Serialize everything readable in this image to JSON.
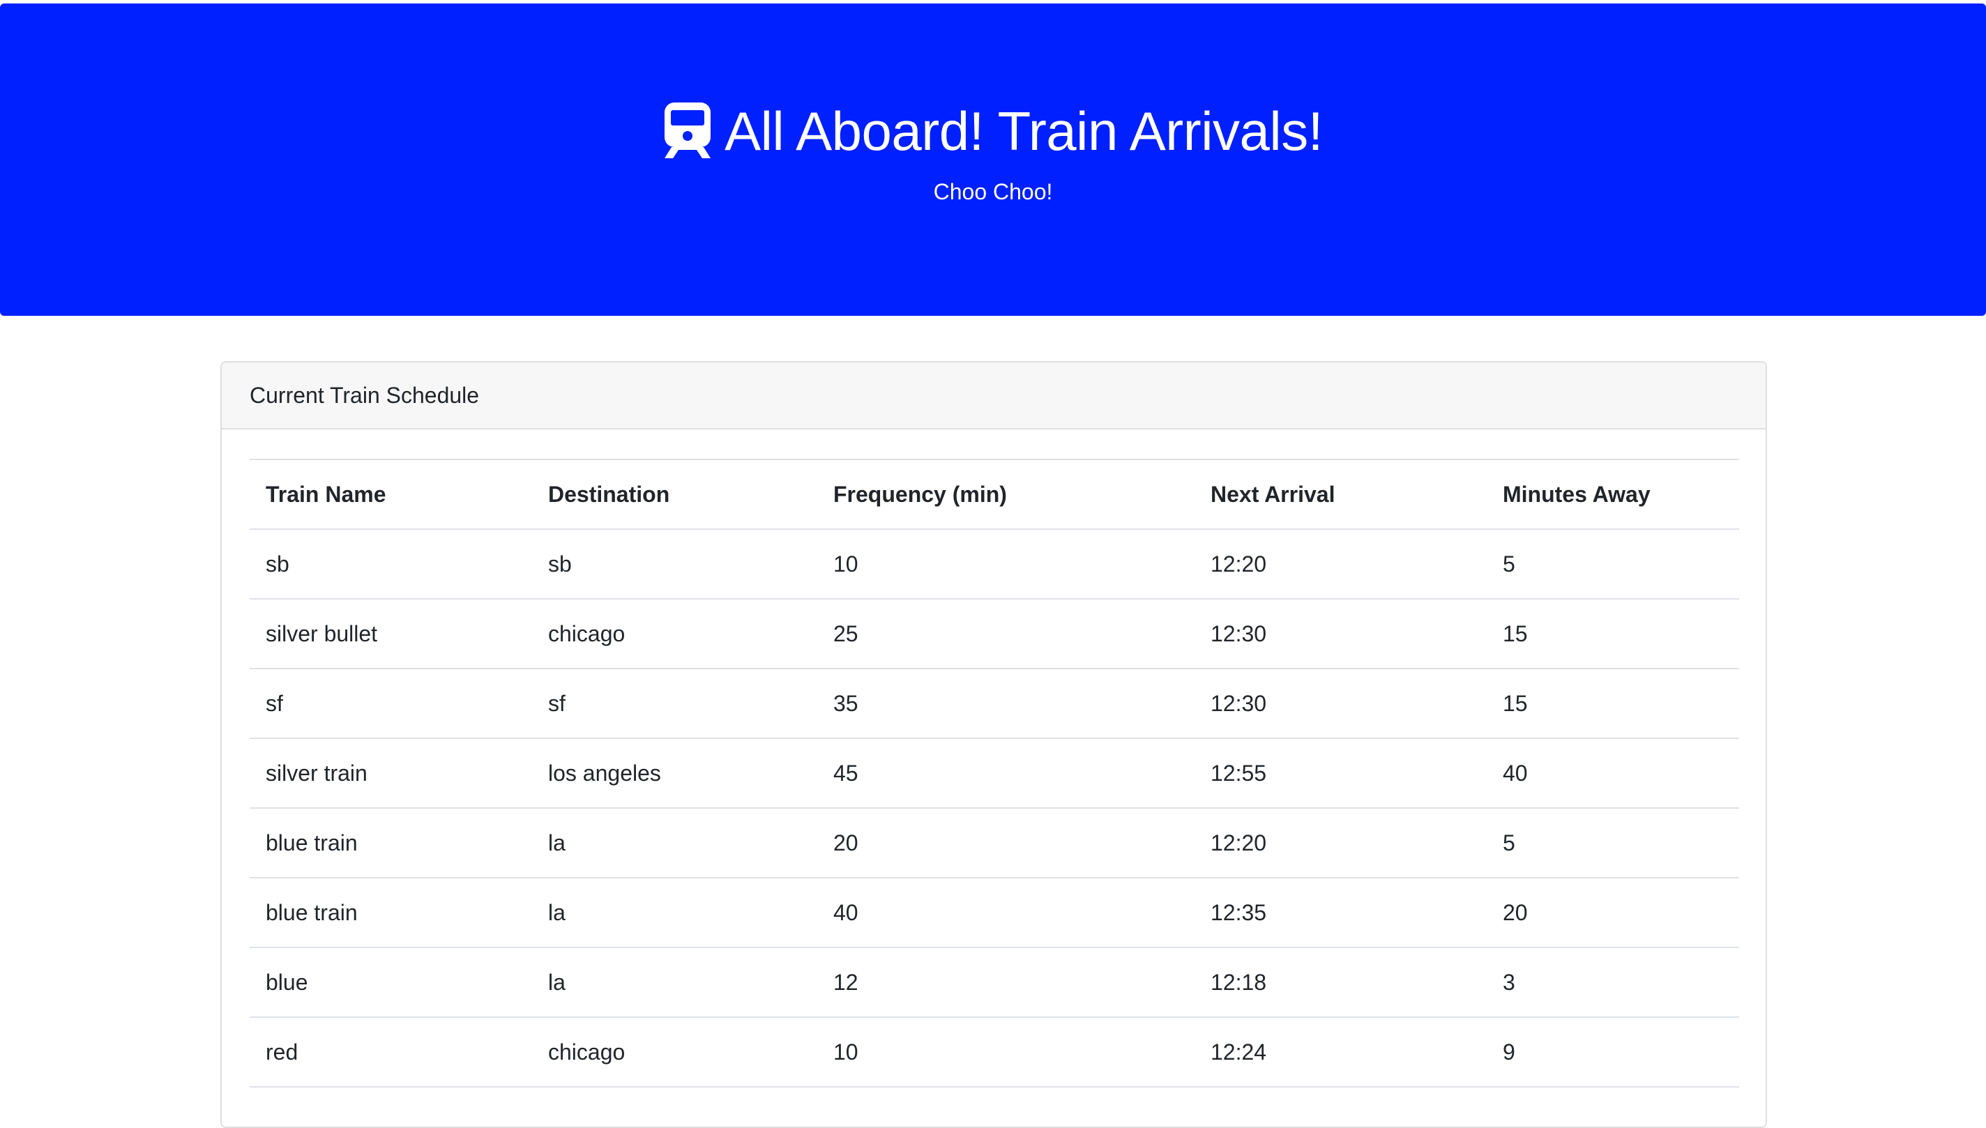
{
  "header": {
    "icon": "train-icon",
    "title": "All Aboard! Train Arrivals!",
    "subtitle": "Choo Choo!",
    "background": "#0020ff"
  },
  "schedule": {
    "title": "Current Train Schedule",
    "columns": [
      "Train Name",
      "Destination",
      "Frequency (min)",
      "Next Arrival",
      "Minutes Away"
    ],
    "rows": [
      [
        "sb",
        "sb",
        "10",
        "12:20",
        "5"
      ],
      [
        "silver bullet",
        "chicago",
        "25",
        "12:30",
        "15"
      ],
      [
        "sf",
        "sf",
        "35",
        "12:30",
        "15"
      ],
      [
        "silver train",
        "los angeles",
        "45",
        "12:55",
        "40"
      ],
      [
        "blue train",
        "la",
        "20",
        "12:20",
        "5"
      ],
      [
        "blue train",
        "la",
        "40",
        "12:35",
        "20"
      ],
      [
        "blue",
        "la",
        "12",
        "12:18",
        "3"
      ],
      [
        "red",
        "chicago",
        "10",
        "12:24",
        "9"
      ]
    ]
  }
}
